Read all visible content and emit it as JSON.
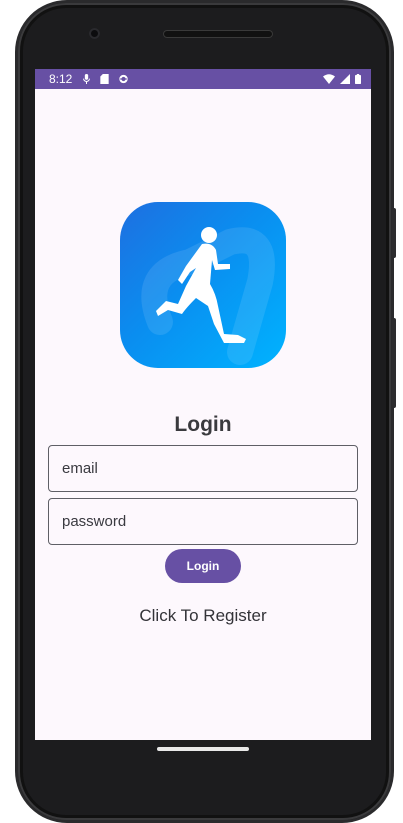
{
  "status_bar": {
    "time": "8:12",
    "left_icons": [
      "mic-icon",
      "sd-card-icon",
      "sync-icon"
    ],
    "right_icons": [
      "wifi-icon",
      "signal-icon",
      "battery-icon"
    ]
  },
  "app": {
    "logo_icon": "runner-icon",
    "title": "Login",
    "email_placeholder": "email",
    "password_placeholder": "password",
    "login_button": "Login",
    "register_link": "Click To Register"
  },
  "colors": {
    "accent": "#6750a4",
    "screen_bg": "#fdf8fd",
    "logo_gradient_start": "#1e6fe0",
    "logo_gradient_end": "#00b3ff"
  }
}
